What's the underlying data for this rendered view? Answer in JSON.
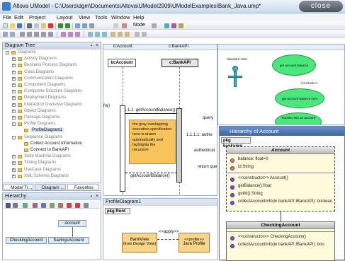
{
  "window": {
    "title": "Altova UModel - C:\\Users\\dgm\\Documents\\Altova\\UModel2009\\UModelExamples\\Bank_Java.ump*",
    "close_label": "close"
  },
  "menu": [
    "File",
    "Edit",
    "Project",
    "Layout",
    "View",
    "Tools",
    "Window",
    "Help"
  ],
  "toolbar": {
    "node_label": "Node"
  },
  "diagram_tree": {
    "title": "Diagram Tree",
    "items": [
      {
        "label": "Diagrams",
        "indent": 0
      },
      {
        "label": "Activity Diagrams",
        "indent": 1
      },
      {
        "label": "Business Process Diagrams",
        "indent": 1
      },
      {
        "label": "Class Diagrams",
        "indent": 1
      },
      {
        "label": "Communication Diagrams",
        "indent": 1
      },
      {
        "label": "Component Diagrams",
        "indent": 1
      },
      {
        "label": "Composite Structure Diagrams",
        "indent": 1
      },
      {
        "label": "Deployment Diagrams",
        "indent": 1
      },
      {
        "label": "Interaction Overview Diagrams",
        "indent": 1
      },
      {
        "label": "Object Diagrams",
        "indent": 1
      },
      {
        "label": "Package Diagrams",
        "indent": 1
      },
      {
        "label": "Profile Diagrams",
        "indent": 1
      },
      {
        "label": "ProfileDiagram1",
        "indent": 2
      },
      {
        "label": "Sequence Diagrams",
        "indent": 1
      },
      {
        "label": "Collect Account Information",
        "indent": 2
      },
      {
        "label": "Connect to BankAPI",
        "indent": 2
      },
      {
        "label": "State Machine Diagrams",
        "indent": 1
      },
      {
        "label": "Timing Diagrams",
        "indent": 1
      },
      {
        "label": "UseCase Diagrams",
        "indent": 1
      },
      {
        "label": "XML Schema Diagrams",
        "indent": 1
      }
    ],
    "tabs": [
      "Model Tr...",
      "Diagram ...",
      "Favorites"
    ]
  },
  "hierarchy_pane": {
    "title": "Hierarchy",
    "account": "Account",
    "checking": "CheckingAccount",
    "savings": "SavingsAccount"
  },
  "sequence": {
    "lifeline1": "b:Account",
    "lifeline2": "c:BankAPI",
    "box1": "bcAccount",
    "box2": "c:BankAPI",
    "msg_left": "fo()",
    "msg1": "1.1.1: getAccountBalance()",
    "msg1_tail": "query",
    "msg2": "1.1.1.1: authe",
    "msg3": "authenticat",
    "msg4": "return que",
    "msg5": "getAccountBalance()",
    "note": "the gray overlapping execution specification here is drawn automatically and highlights the recursion"
  },
  "usecase": {
    "actor": "Standard User",
    "u1": "get account balance",
    "u2": "get account balance sum",
    "u3": "Transfer into an account",
    "include": "<<include>>"
  },
  "hierarchy_window": {
    "title": "Hierarchy of Account",
    "pkg": "pkg bankview",
    "class_name": "Account",
    "attrs": [
      "balance: float=0",
      "id:String"
    ],
    "ops": [
      "<<constructor>> Account()",
      "getBalance():float",
      "getId():String",
      "collectAccountInfo(in bankAPI:IBankAPI): boolean"
    ],
    "sub_class": "CheckingAccount",
    "sub_ops": [
      "<<constructor>> CheckingAccount()",
      "collectAccountInfo(in bankAPI:IBankAPI): boo"
    ]
  },
  "profile": {
    "title": "ProfileDiagram1",
    "pkg": "pkg Root",
    "bankview": "BankView",
    "from_design": "(from Design View)",
    "apply": "<<apply>>",
    "profile_stereo": "<<profile>>",
    "java_profile": "Java Profile"
  }
}
